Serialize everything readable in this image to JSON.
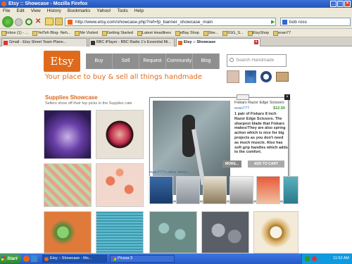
{
  "window": {
    "title": "Etsy :: Showcase - Mozilla Firefox"
  },
  "menu": [
    "File",
    "Edit",
    "View",
    "History",
    "Bookmarks",
    "Yahoo!",
    "Tools",
    "Help"
  ],
  "address": {
    "url": "http://www.etsy.com/showcase.php?ref=fp_banner_showcase_main"
  },
  "search": {
    "value": "bob ross"
  },
  "bookmarks": [
    "Inbox (1) - ...",
    "YetTeh Blog- Neh...",
    "Me Visited",
    "Getting Started",
    "Latest Headlines",
    "eBay Shop",
    "Sbe...",
    "5SG_S...",
    "EtsyShop",
    "evan77"
  ],
  "tabs": [
    {
      "label": "Gmail - Etsy Street Team Plane...",
      "active": false
    },
    {
      "label": "BBC iPlayer - BBC Radio 1's Essential Mi...",
      "active": false
    },
    {
      "label": "Etsy :: Showcase",
      "active": true
    }
  ],
  "etsy": {
    "logo": "Etsy",
    "nav": [
      "Buy",
      "Sell",
      "Request",
      "Community",
      "Blog"
    ],
    "search_placeholder": "Search Handmade",
    "tagline": "Your place to buy & sell all things handmade",
    "section_title": "Supplies Showcase",
    "section_sub": "Sellers show off their top picks in the Supplies cate"
  },
  "popup": {
    "title": "Fiskars Razor Edge Scissors",
    "seller": "evan777",
    "price": "$12.50",
    "description": "1 pair of Fiskars 8 inch Razor Edge Scissors. The sharpest blade that Fiskars makes!They are also spring action which is nice for big projects as you don't need as much muscle. Also has soft grip handles which adds to the comfort.",
    "more_button": "MORE...",
    "cart_button": "ADD TO CART",
    "other_items": "evan777's other items..."
  },
  "taskbar": {
    "start": "Start",
    "items": [
      "Etsy :: Showcase - Mo...",
      "Picasa 3"
    ],
    "clock": "11:52 AM"
  },
  "colors": {
    "etsy_orange": "#e06a1b",
    "nav_gray": "#8f8f8f",
    "link_blue": "#2a6ebb",
    "price_green": "#3d8d2c"
  }
}
